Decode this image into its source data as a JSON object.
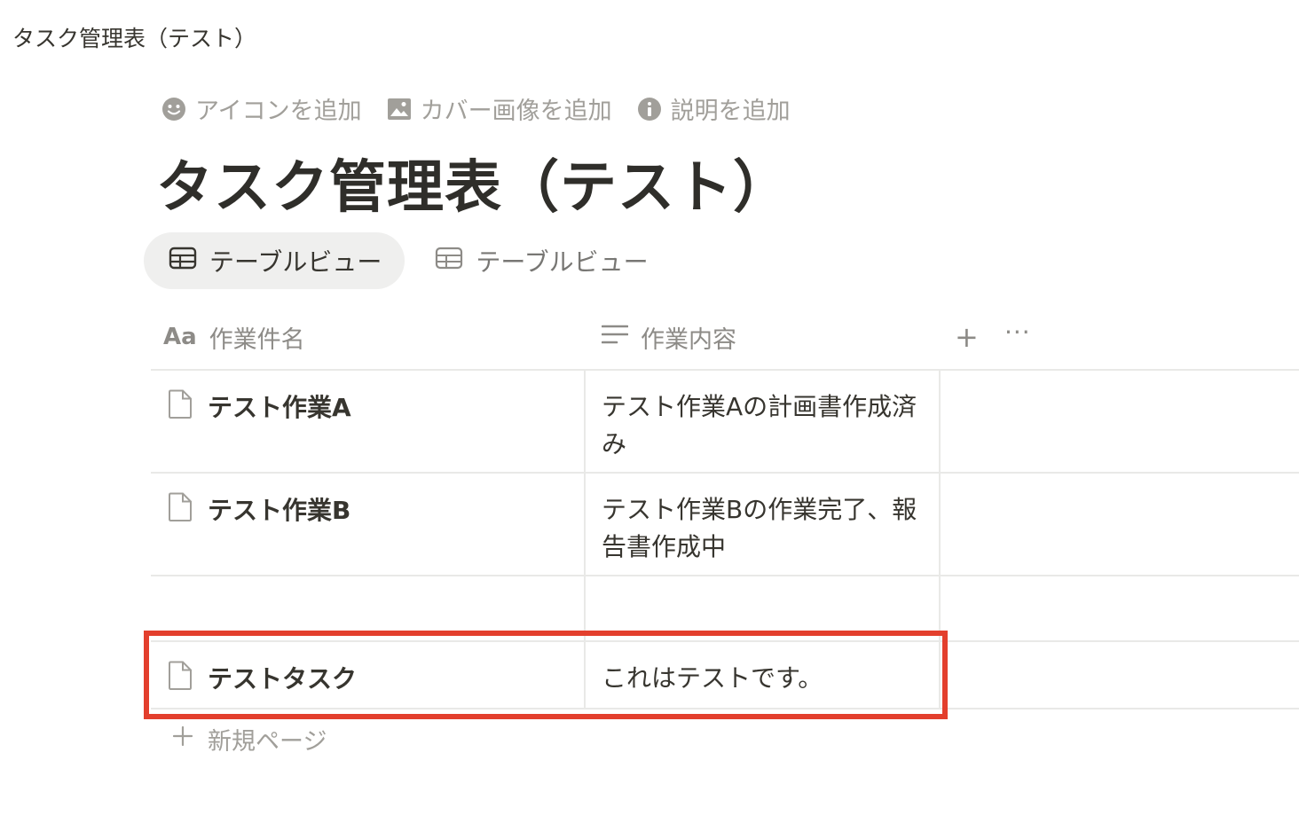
{
  "breadcrumb": {
    "title": "タスク管理表（テスト）"
  },
  "page_actions": [
    {
      "label": "アイコンを追加",
      "icon": "smiley-icon"
    },
    {
      "label": "カバー画像を追加",
      "icon": "image-icon"
    },
    {
      "label": "説明を追加",
      "icon": "info-icon"
    }
  ],
  "page": {
    "title": "タスク管理表（テスト）"
  },
  "views": [
    {
      "label": "テーブルビュー",
      "active": true,
      "icon": "table-icon"
    },
    {
      "label": "テーブルビュー",
      "active": false,
      "icon": "table-icon"
    }
  ],
  "table": {
    "columns": [
      {
        "label": "作業件名",
        "icon_text": "Aa",
        "icon": "text-property-icon"
      },
      {
        "label": "作業内容",
        "icon": "lines-property-icon"
      }
    ],
    "add_column_label": "+",
    "more_label": "···",
    "rows": [
      {
        "name": "テスト作業A",
        "content": "テスト作業Aの計画書作成済み"
      },
      {
        "name": "テスト作業B",
        "content": "テスト作業Bの作業完了、報告書作成中"
      },
      {
        "name": "",
        "content": ""
      },
      {
        "name": "テストタスク",
        "content": "これはテストです。"
      }
    ],
    "new_page_label": "新規ページ"
  },
  "colors": {
    "highlight": "#e33f2d",
    "muted_text": "#a19f9a",
    "active_tab_bg": "#efefee",
    "border": "#e9e9e7"
  }
}
